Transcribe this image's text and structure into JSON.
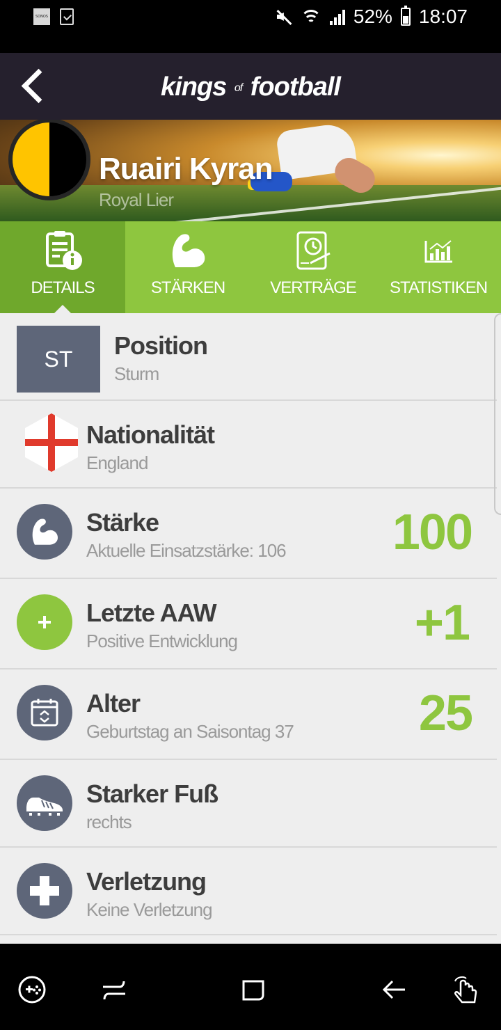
{
  "status_bar": {
    "battery": "52%",
    "time": "18:07",
    "sonos_label": "SONOS",
    "icons": [
      "sonos-icon",
      "checkbox-icon",
      "mute-icon",
      "wifi-icon",
      "signal-icon",
      "battery-icon"
    ]
  },
  "header": {
    "logo_kings": "kings",
    "logo_of": "of",
    "logo_football": "football"
  },
  "player": {
    "name": "Ruairi Kyran",
    "club": "Royal Lier",
    "crest_colors": [
      "#ffc400",
      "#000000"
    ]
  },
  "tabs": [
    {
      "label": "DETAILS",
      "icon": "details-info-icon",
      "active": true
    },
    {
      "label": "STÄRKEN",
      "icon": "flexed-arm-icon",
      "active": false
    },
    {
      "label": "VERTRÄGE",
      "icon": "contract-clock-icon",
      "active": false
    },
    {
      "label": "STATISTIKEN",
      "icon": "bar-chart-icon",
      "active": false
    }
  ],
  "details": {
    "position": {
      "badge": "ST",
      "title": "Position",
      "subtitle": "Sturm"
    },
    "nationality": {
      "title": "Nationalität",
      "subtitle": "England",
      "icon": "england-flag-icon"
    },
    "strength": {
      "title": "Stärke",
      "subtitle": "Aktuelle Einsatzstärke: 106",
      "value": "100",
      "icon": "flexed-arm-icon"
    },
    "last_aaw": {
      "title": "Letzte AAW",
      "subtitle": "Positive Entwicklung",
      "value": "+1",
      "icon": "plus-icon"
    },
    "age": {
      "title": "Alter",
      "subtitle": "Geburtstag an Saisontag 37",
      "value": "25",
      "icon": "calendar-icon"
    },
    "foot": {
      "title": "Starker Fuß",
      "subtitle": "rechts",
      "icon": "football-boot-icon"
    },
    "injury": {
      "title": "Verletzung",
      "subtitle": "Keine Verletzung",
      "icon": "medical-cross-icon"
    }
  },
  "colors": {
    "accent_green": "#8ec63f",
    "tab_active": "#6fa82c",
    "icon_slate": "#5e6679",
    "header_bg": "#25202d"
  }
}
